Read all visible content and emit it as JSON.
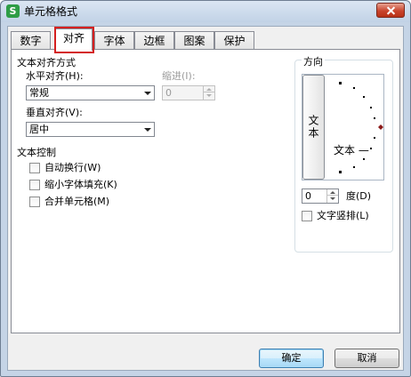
{
  "window": {
    "title": "单元格格式",
    "app_icon_letter": "S"
  },
  "tabs": [
    {
      "label": "数字",
      "active": false
    },
    {
      "label": "对齐",
      "active": true
    },
    {
      "label": "字体",
      "active": false
    },
    {
      "label": "边框",
      "active": false
    },
    {
      "label": "图案",
      "active": false
    },
    {
      "label": "保护",
      "active": false
    }
  ],
  "text_alignment": {
    "group_title": "文本对齐方式",
    "horizontal_label": "水平对齐(H):",
    "horizontal_value": "常规",
    "indent_label": "缩进(I):",
    "indent_value": "0",
    "vertical_label": "垂直对齐(V):",
    "vertical_value": "居中"
  },
  "text_control": {
    "group_title": "文本控制",
    "wrap_text": "自动换行(W)",
    "shrink_to_fit": "缩小字体填充(K)",
    "merge_cells": "合并单元格(M)"
  },
  "orientation": {
    "group_title": "方向",
    "vertical_text": "文本",
    "dial_text": "文本 —",
    "degrees_value": "0",
    "degrees_label": "度(D)",
    "vertical_stack_label": "文字竖排(L)"
  },
  "buttons": {
    "ok": "确定",
    "cancel": "取消"
  },
  "colors": {
    "tab_highlight": "#d42020",
    "dial_marker": "#8b1a1a",
    "app_icon": "#2e9d46"
  }
}
